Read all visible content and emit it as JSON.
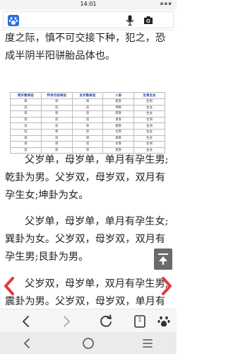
{
  "status_bar": {
    "time": "14:01"
  },
  "search": {
    "placeholder": ""
  },
  "article": {
    "para1": "度之际，慎不可交接下种，犯之，恐成半阴半阳骈胎品体也。",
    "para2": "父岁单，母岁单，单月有孕生男;乾卦为男。父岁双，母岁双，双月有孕生女;坤卦为女。",
    "para3": "父岁单，母岁单，单月有孕生女;巽卦为女。父岁双，母岁双，双月有孕生男;艮卦为男。",
    "para4": "父岁双，母岁单，双月有孕生男;震卦为男。父岁双，母岁双，单月有孕生女;"
  },
  "table": {
    "headers": [
      "男岁数单双",
      "怀孕月份单双",
      "女岁数单双",
      "八卦",
      "生男生女"
    ],
    "rows": [
      [
        "单",
        "单",
        "单",
        "乾卦",
        "生男"
      ],
      [
        "双",
        "双",
        "双",
        "坤卦",
        "生女"
      ],
      [
        "单",
        "单",
        "单",
        "巽卦",
        "生女"
      ],
      [
        "双",
        "双",
        "双",
        "艮卦",
        "生男"
      ],
      [
        "双",
        "双",
        "单",
        "震卦",
        "生男"
      ],
      [
        "双",
        "单",
        "双",
        "兑卦",
        "生女"
      ],
      [
        "单",
        "双",
        "单",
        "离卦",
        "生女"
      ],
      [
        "单",
        "单",
        "双",
        "坎卦",
        "生男"
      ],
      [
        "双",
        "单",
        "单",
        "艮卦",
        "生女"
      ]
    ]
  },
  "toolbar": {
    "pages_count": "1"
  },
  "colors": {
    "accent": "#2f6ee0",
    "page_arrow": "#e03c3c",
    "header_text": "#1a3f9e"
  },
  "icons": {
    "search_logo": "baidu-paw-icon",
    "voice": "microphone-icon",
    "camera": "camera-icon",
    "scroll_top": "scroll-to-top-icon",
    "back": "back-arrow-icon",
    "forward": "forward-arrow-icon",
    "refresh": "refresh-icon",
    "pages": "pages-icon",
    "assistant": "paw-icon"
  }
}
